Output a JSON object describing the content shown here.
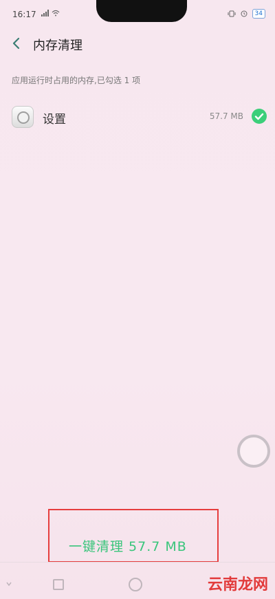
{
  "status": {
    "time": "16:17",
    "battery": "34"
  },
  "header": {
    "title": "内存清理"
  },
  "subtitle": "应用运行时占用的内存,已勾选 1 项",
  "apps": [
    {
      "name": "设置",
      "size": "57.7 MB",
      "checked": true
    }
  ],
  "action": {
    "label": "一键清理 57.7 MB"
  },
  "watermark": "云南龙网",
  "colors": {
    "accent": "#3ccf7a",
    "highlight_box": "#e63d3d",
    "background": "#f7e6ee"
  },
  "icons": {
    "back": "chevron-left-icon",
    "app": "settings-icon",
    "check": "check-circle-icon",
    "float_ball": "floating-assist-icon"
  }
}
